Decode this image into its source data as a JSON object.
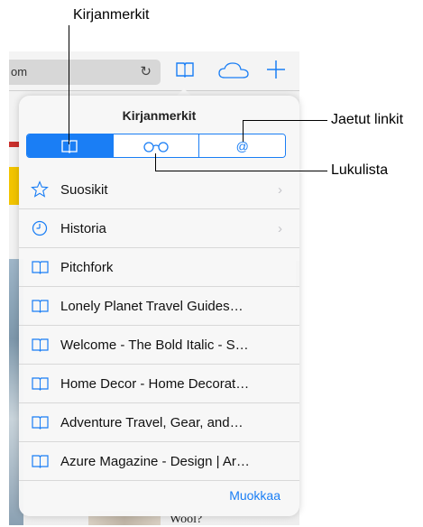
{
  "callouts": {
    "bookmarks": "Kirjanmerkit",
    "shared_links": "Jaetut linkit",
    "reading_list": "Lukulista"
  },
  "browser": {
    "address_text": "om",
    "reload_icon": "reload-icon",
    "bookmarks_icon": "book-icon",
    "icloud_icon": "cloud-icon",
    "new_tab_icon": "plus-icon"
  },
  "background_page": {
    "text_snippet": "Wool?"
  },
  "popover": {
    "title": "Kirjanmerkit",
    "segments": [
      {
        "icon": "book-icon",
        "label": "▯"
      },
      {
        "icon": "glasses-icon",
        "label": "○○"
      },
      {
        "icon": "at-icon",
        "label": "@"
      }
    ],
    "active_segment": 0,
    "items": [
      {
        "label": "Suosikit",
        "icon": "star-icon",
        "chevron": "›"
      },
      {
        "label": "Historia",
        "icon": "clock-icon",
        "chevron": "›"
      },
      {
        "label": "Pitchfork",
        "icon": "book-icon"
      },
      {
        "label": "Lonely Planet Travel Guides…",
        "icon": "book-icon"
      },
      {
        "label": "Welcome - The Bold Italic - S…",
        "icon": "book-icon"
      },
      {
        "label": "Home Decor - Home Decorat…",
        "icon": "book-icon"
      },
      {
        "label": "Adventure Travel, Gear, and…",
        "icon": "book-icon"
      },
      {
        "label": "Azure Magazine - Design | Ar…",
        "icon": "book-icon"
      }
    ],
    "edit_label": "Muokkaa"
  },
  "colors": {
    "accent": "#1a7ef5"
  }
}
